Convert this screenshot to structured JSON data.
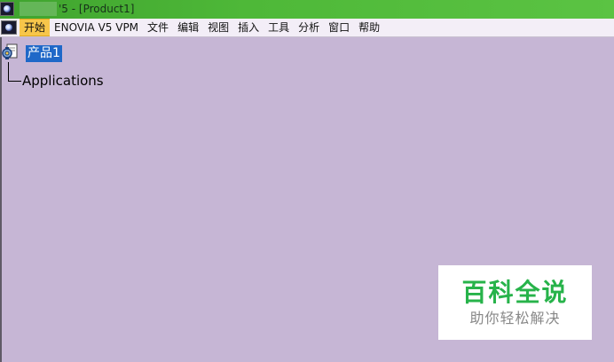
{
  "window": {
    "title": "'5 - [Product1]",
    "app_icon": "catia-app-icon"
  },
  "menu": {
    "doc_icon": "catia-document-icon",
    "items": [
      {
        "label": "开始",
        "active": true
      },
      {
        "label": "ENOVIA V5 VPM"
      },
      {
        "label": "文件"
      },
      {
        "label": "编辑"
      },
      {
        "label": "视图"
      },
      {
        "label": "插入"
      },
      {
        "label": "工具"
      },
      {
        "label": "分析"
      },
      {
        "label": "窗口"
      },
      {
        "label": "帮助"
      }
    ]
  },
  "tree": {
    "root": {
      "label": "产品1",
      "icon": "product-gear-icon",
      "selected": true
    },
    "children": [
      {
        "label": "Applications"
      }
    ]
  },
  "watermark": {
    "title": "百科全说",
    "subtitle": "助你轻松解决"
  },
  "colors": {
    "background": "#c6b6d5",
    "titlebar": "#4eb838",
    "menu_active": "#f7c64a",
    "selection": "#1f68c8",
    "watermark_green": "#27b34a"
  }
}
